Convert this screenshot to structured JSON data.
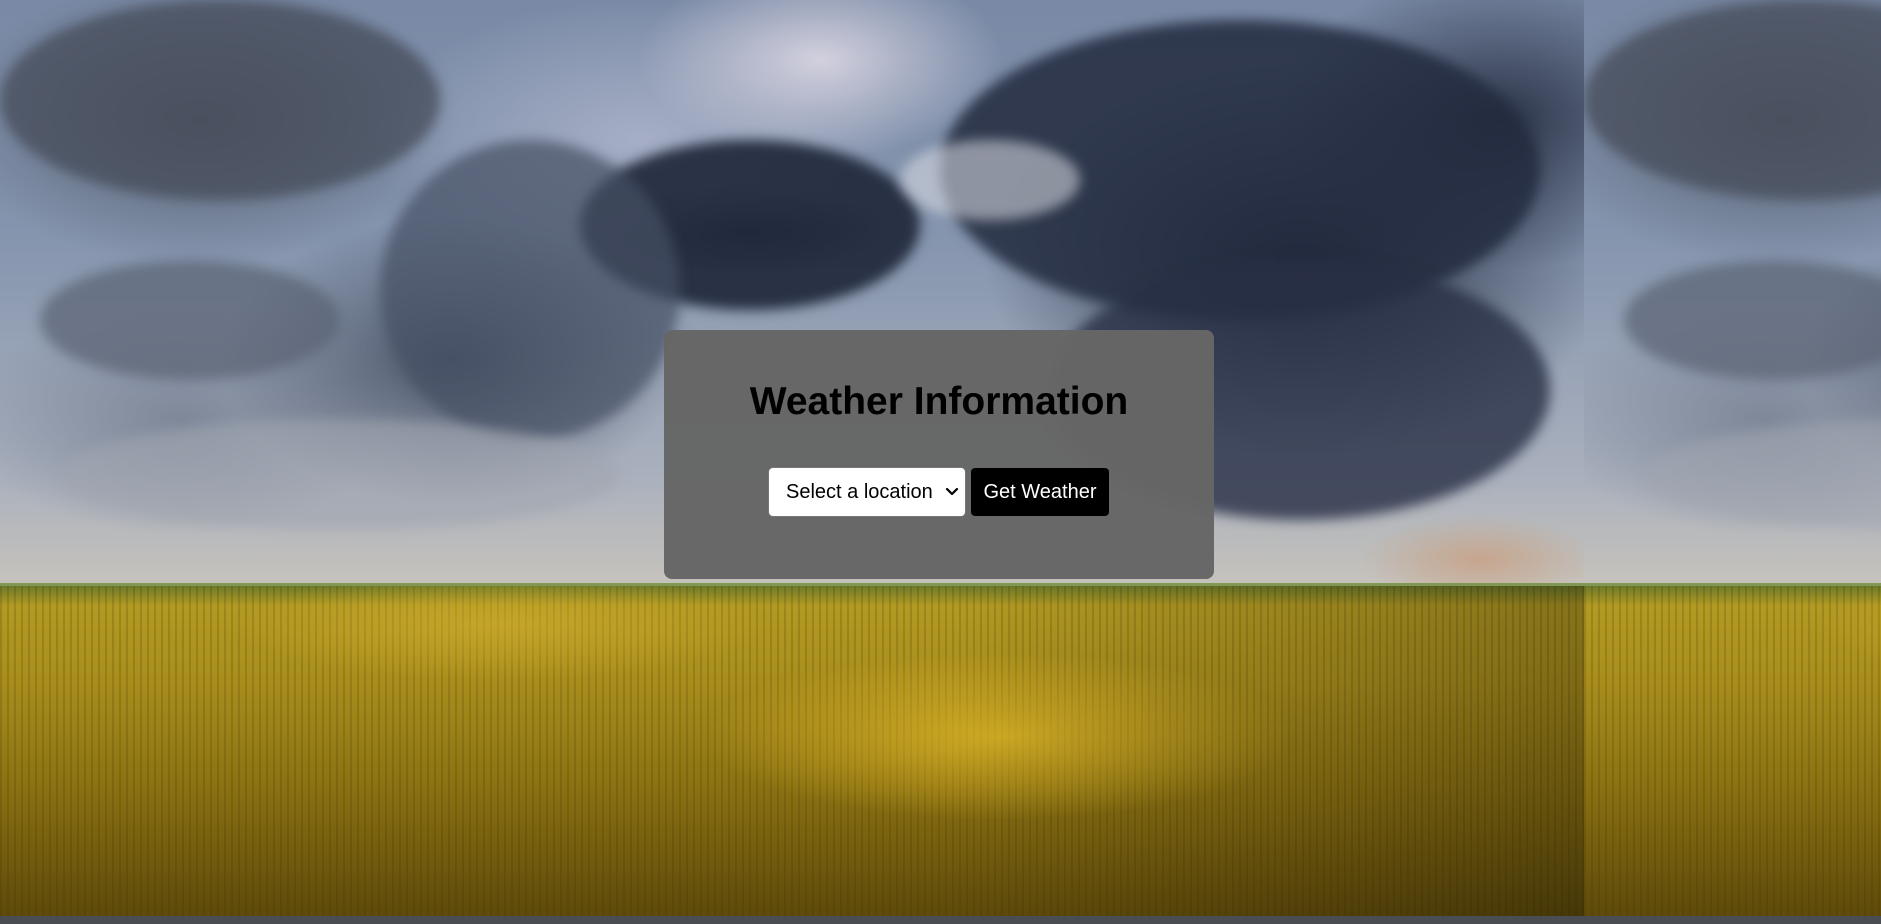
{
  "page": {
    "title": "Weather Information"
  },
  "controls": {
    "location_select": {
      "selected": "Select a location",
      "options": [
        "Select a location"
      ]
    },
    "get_weather_label": "Get Weather"
  },
  "background": {
    "description": "stormy sky over golden wheat field",
    "colors": {
      "card": "#666666",
      "button": "#000000",
      "button_text": "#ffffff"
    }
  },
  "icons": {
    "select_arrow": "chevron-down-icon"
  }
}
